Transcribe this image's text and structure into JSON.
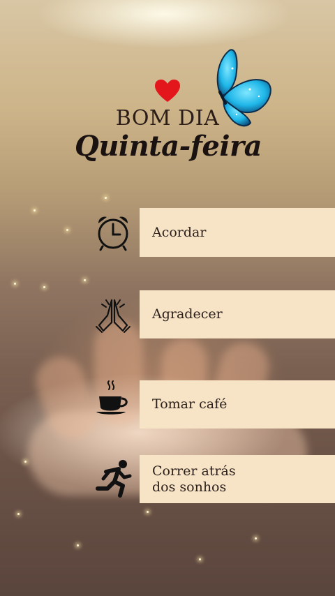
{
  "header": {
    "line1": "BOM DIA",
    "line2": "Quinta-feira"
  },
  "items": [
    {
      "label": "Acordar",
      "icon": "alarm-clock-icon"
    },
    {
      "label": "Agradecer",
      "icon": "praying-hands-icon"
    },
    {
      "label": "Tomar café",
      "icon": "coffee-cup-icon"
    },
    {
      "label": "Correr atrás dos sonhos",
      "icon": "running-person-icon"
    }
  ],
  "colors": {
    "box": "#f7e3c6",
    "heart": "#e3161c",
    "butterfly": "#1fb6e8"
  }
}
